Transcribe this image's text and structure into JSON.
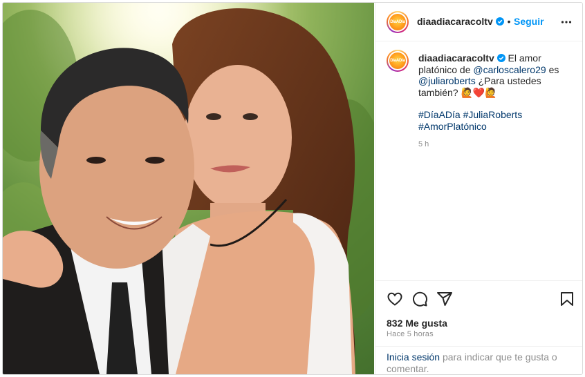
{
  "account": {
    "username": "diaadiacaracoltv",
    "avatar_text": "DíaADía"
  },
  "header": {
    "follow_label": "Seguir",
    "more_icon": "more-horizontal-icon"
  },
  "caption": {
    "text_1": "El amor platónico de",
    "mention_1": "@carloscalero29",
    "text_2": "es",
    "mention_2": "@juliaroberts",
    "text_3": "¿Para ustedes también?",
    "emojis": "🙋❤️🙋",
    "hashtag_1": "#DíaADía",
    "hashtag_2": "#JuliaRoberts",
    "hashtag_3": "#AmorPlatónico",
    "time": "5 h"
  },
  "actions": {
    "like_icon": "heart-icon",
    "comment_icon": "comment-icon",
    "share_icon": "send-icon",
    "save_icon": "bookmark-icon",
    "likes": "832 Me gusta",
    "posted_ago": "Hace 5 horas"
  },
  "footer": {
    "login_label": "Inicia sesión",
    "rest": "para indicar que te gusta o comentar."
  },
  "colors": {
    "accent": "#0095f6",
    "link": "#00376b",
    "verified": "#0095f6",
    "heart": "#e0245e"
  }
}
